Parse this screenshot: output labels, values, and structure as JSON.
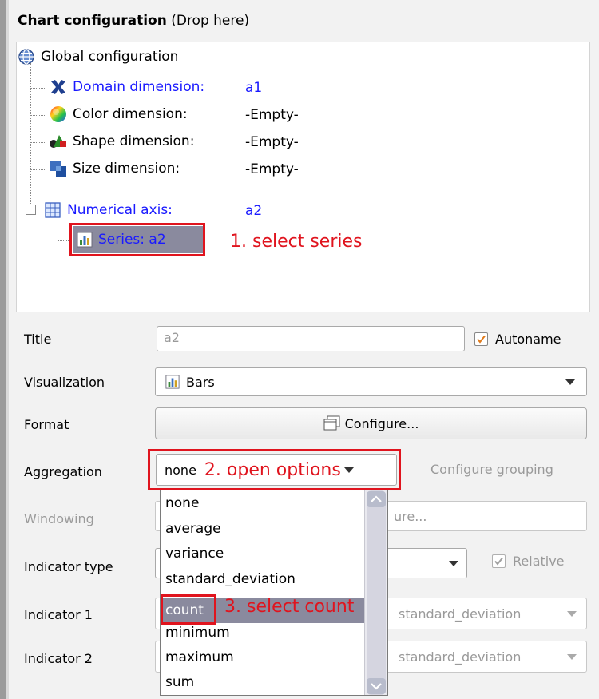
{
  "panel": {
    "title_bold": "Chart configuration",
    "title_rest": " (Drop here)"
  },
  "tree": {
    "global": "Global configuration",
    "domain_label": "Domain dimension:",
    "domain_value": "a1",
    "color_label": "Color dimension:",
    "color_value": "-Empty-",
    "shape_label": "Shape dimension:",
    "shape_value": "-Empty-",
    "size_label": "Size dimension:",
    "size_value": "-Empty-",
    "numerical_label": "Numerical axis:",
    "numerical_value": "a2",
    "series_label": "Series: a2",
    "expander": "−"
  },
  "annotations": {
    "step1": "1. select series",
    "step2": "2. open options",
    "step3": "3. select count"
  },
  "form": {
    "title_label": "Title",
    "title_value": "a2",
    "autoname_label": "Autoname",
    "visualization_label": "Visualization",
    "visualization_value": "Bars",
    "format_label": "Format",
    "configure_label": "Configure...",
    "aggregation_label": "Aggregation",
    "aggregation_value": "none",
    "configure_grouping_label": "Configure grouping",
    "windowing_label": "Windowing",
    "windowing_btn_partial": "ure...",
    "indicator_type_label": "Indicator type",
    "relative_label": "Relative",
    "indicator1_label": "Indicator 1",
    "indicator1_value": "standard_deviation",
    "indicator2_label": "Indicator 2",
    "indicator2_value": "standard_deviation"
  },
  "dropdown": {
    "options": [
      "none",
      "average",
      "variance",
      "standard_deviation",
      "count",
      "minimum",
      "maximum",
      "sum"
    ],
    "selected": "count"
  },
  "colors": {
    "annotation_red": "#e0141e",
    "tree_blue": "#1a1aff",
    "selection_bg": "#8a8a9e"
  }
}
